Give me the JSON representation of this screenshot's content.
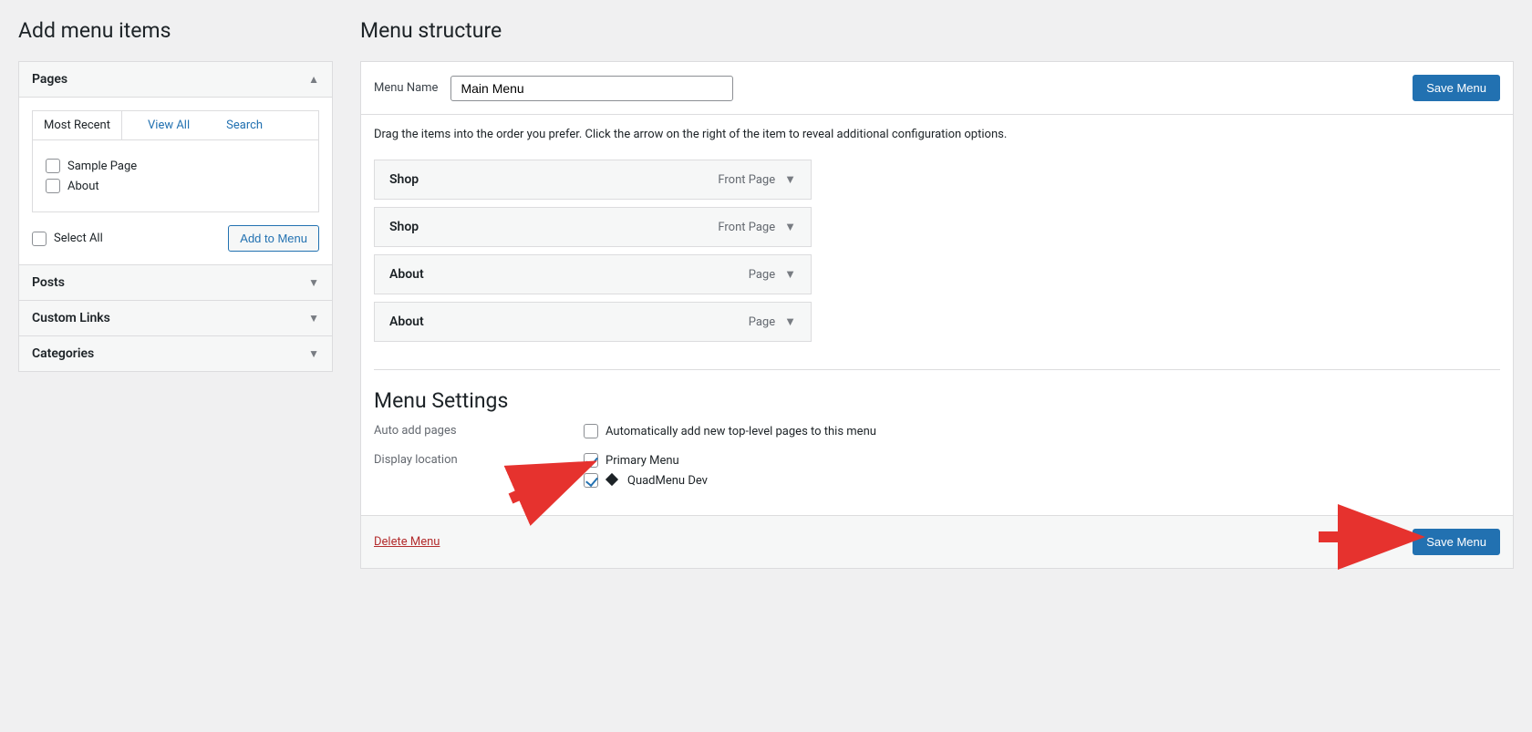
{
  "left": {
    "heading": "Add menu items",
    "panels": {
      "pages": {
        "title": "Pages",
        "tabs": [
          "Most Recent",
          "View All",
          "Search"
        ],
        "active_tab": "Most Recent",
        "items": [
          "Sample Page",
          "About"
        ],
        "select_all": "Select All",
        "add_button": "Add to Menu"
      },
      "posts": "Posts",
      "custom_links": "Custom Links",
      "categories": "Categories"
    }
  },
  "right": {
    "heading": "Menu structure",
    "menu_name_label": "Menu Name",
    "menu_name_value": "Main Menu",
    "save_button": "Save Menu",
    "instructions": "Drag the items into the order you prefer. Click the arrow on the right of the item to reveal additional configuration options.",
    "items": [
      {
        "title": "Shop",
        "type": "Front Page"
      },
      {
        "title": "Shop",
        "type": "Front Page"
      },
      {
        "title": "About",
        "type": "Page"
      },
      {
        "title": "About",
        "type": "Page"
      }
    ],
    "settings": {
      "heading": "Menu Settings",
      "auto_add_label": "Auto add pages",
      "auto_add_option": "Automatically add new top-level pages to this menu",
      "display_loc_label": "Display location",
      "locations": [
        {
          "label": "Primary Menu",
          "checked": true,
          "icon": false
        },
        {
          "label": "QuadMenu Dev",
          "checked": true,
          "icon": true
        }
      ]
    },
    "delete_link": "Delete Menu",
    "save_button_footer": "Save Menu"
  }
}
